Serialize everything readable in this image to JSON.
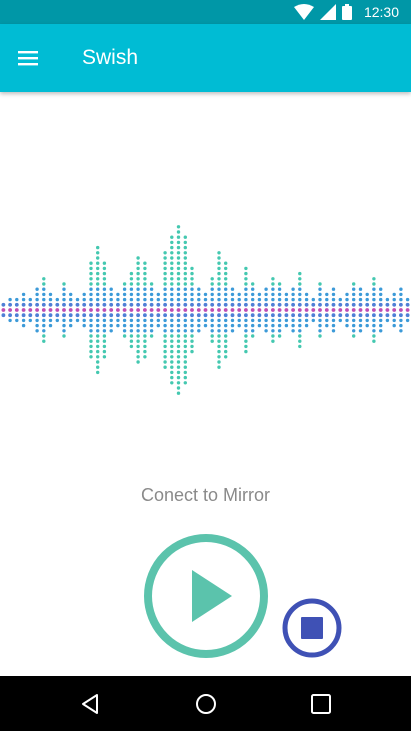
{
  "status_bar": {
    "time": "12:30",
    "background": "#0097a7"
  },
  "app_bar": {
    "title": "Swish",
    "background": "#00bcd4",
    "menu_icon": "hamburger-menu-icon"
  },
  "visualizer": {
    "description_icon": "audio-waveform",
    "colors": [
      "#44c8b0",
      "#3c9ad8",
      "#4f7fd6",
      "#c04db2"
    ],
    "column_levels": [
      1,
      2,
      2,
      3,
      2,
      4,
      6,
      3,
      2,
      5,
      3,
      2,
      3,
      9,
      12,
      9,
      4,
      3,
      5,
      7,
      10,
      9,
      5,
      3,
      11,
      14,
      16,
      14,
      8,
      4,
      3,
      6,
      11,
      9,
      4,
      3,
      8,
      5,
      3,
      4,
      6,
      5,
      3,
      4,
      7,
      3,
      2,
      5,
      3,
      4,
      2,
      3,
      5,
      4,
      3,
      6,
      4,
      2,
      3,
      4,
      2
    ]
  },
  "main": {
    "caption": "Conect to Mirror"
  },
  "controls": {
    "play_icon": "play-icon",
    "play_color": "#5bc3ac",
    "stop_icon": "stop-icon",
    "stop_color": "#3f51b5"
  },
  "nav_bar": {
    "back_icon": "back-triangle-icon",
    "home_icon": "home-circle-icon",
    "recents_icon": "recents-square-icon"
  }
}
